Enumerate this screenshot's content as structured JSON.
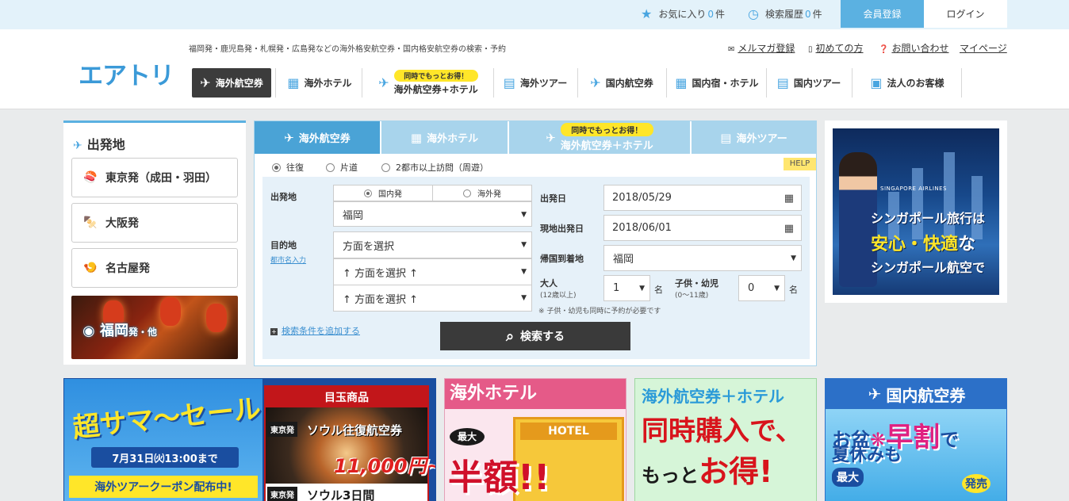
{
  "topbar": {
    "favorites_label": "お気に入り",
    "favorites_count": "0",
    "favorites_unit": "件",
    "history_label": "検索履歴",
    "history_count": "0",
    "history_unit": "件",
    "register": "会員登録",
    "login": "ログイン"
  },
  "header": {
    "logo": "エアトリ",
    "tagline": "福岡発・鹿児島発・札幌発・広島発などの海外格安航空券・国内格安航空券の検索・予約",
    "links": [
      "メルマガ登録",
      "初めての方",
      "お問い合わせ",
      "マイページ"
    ]
  },
  "nav": {
    "items": [
      {
        "label": "海外航空券",
        "badge": ""
      },
      {
        "label": "海外ホテル",
        "badge": ""
      },
      {
        "label": "海外航空券+ホテル",
        "badge": "同時でもっとお得！"
      },
      {
        "label": "海外ツアー",
        "badge": ""
      },
      {
        "label": "国内航空券",
        "badge": ""
      },
      {
        "label": "国内宿・ホテル",
        "badge": ""
      },
      {
        "label": "国内ツアー",
        "badge": ""
      },
      {
        "label": "法人のお客様",
        "badge": ""
      }
    ]
  },
  "sidebar": {
    "title": "出発地",
    "items": [
      "東京発（成田・羽田）",
      "大阪発",
      "名古屋発"
    ],
    "feature_city": "福岡",
    "feature_suffix": "発・他"
  },
  "search": {
    "tabs": [
      {
        "label": "海外航空券",
        "badge": ""
      },
      {
        "label": "海外ホテル",
        "badge": ""
      },
      {
        "label": "海外航空券＋ホテル",
        "badge": "同時でもっとお得！"
      },
      {
        "label": "海外ツアー",
        "badge": ""
      }
    ],
    "trip_types": [
      "往復",
      "片道",
      "2都市以上訪問（周遊）"
    ],
    "help": "HELP",
    "origin_label": "出発地",
    "origin_tabs": [
      "国内発",
      "海外発"
    ],
    "origin_value": "福岡",
    "dest_label": "目的地",
    "dest_link": "都市名入力",
    "dest_values": [
      "方面を選択",
      "↑ 方面を選択 ↑",
      "↑ 方面を選択 ↑"
    ],
    "depart_label": "出発日",
    "depart_value": "2018/05/29",
    "return_label": "現地出発日",
    "return_value": "2018/06/01",
    "arrive_label": "帰国到着地",
    "arrive_value": "福岡",
    "adult_label": "大人",
    "adult_sub": "(12歳以上)",
    "adult_value": "1",
    "child_label": "子供・幼児",
    "child_sub": "(0〜11歳)",
    "child_value": "0",
    "unit": "名",
    "note": "※ 子供・幼児も同時に予約が必要です",
    "add_condition": "検索条件を追加する",
    "submit": "検索する"
  },
  "ad_right": {
    "airline": "SINGAPORE AIRLINES",
    "line1": "シンガポール旅行は",
    "line2a": "安心・快適",
    "line2b": "な",
    "line3": "シンガポール航空で"
  },
  "banners": {
    "sale_title": "超サマ〜セール",
    "sale_date": "7月31日㈫13:00まで",
    "sale_coupon": "海外ツアークーポン配布中!",
    "sale_featured": "目玉商品",
    "sale_tag": "東京発",
    "sale_route1": "ソウル往復航空券",
    "sale_price": "11,000円~",
    "sale_route2": "ソウル3日間",
    "hotel_title": "海外ホテル",
    "hotel_sign": "HOTEL",
    "hotel_max": "最大",
    "hotel_half": "半額!!",
    "combo_title": "海外航空券＋ホテル",
    "combo_l1": "同時購入で、",
    "combo_l2a": "もっと",
    "combo_l2b": "お得!",
    "dom_title": "国内航空券",
    "dom_l1a": "お盆",
    "dom_l1b": "早割",
    "dom_l1c": "で",
    "dom_l2": "夏休みも",
    "dom_max": "最大",
    "dom_release": "発売"
  },
  "colors": {
    "accent": "#4aa3d6",
    "dark_button": "#3a3a3a",
    "topbar_bg": "#e3f2fa"
  }
}
